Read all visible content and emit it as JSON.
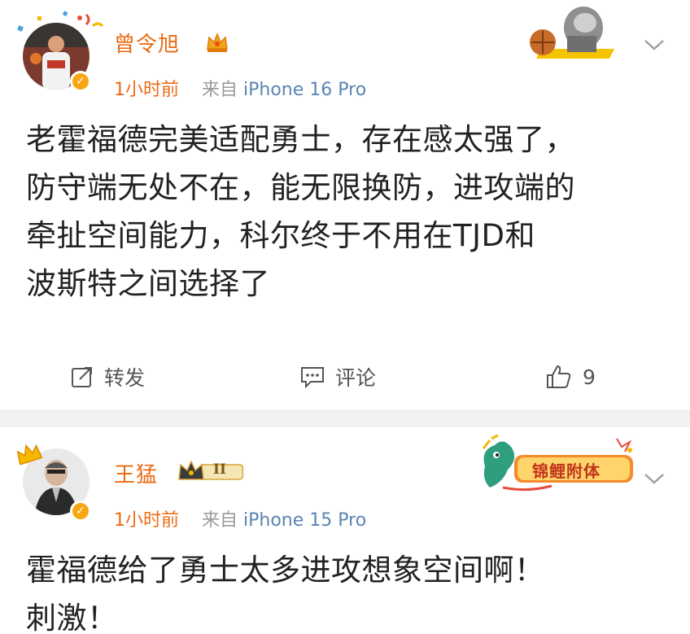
{
  "posts": [
    {
      "username": "曾令旭",
      "time": "1小时前",
      "source_prefix": "来自",
      "device": "iPhone 16 Pro",
      "content_lines": [
        "老霍福德完美适配勇士，存在感太强了，",
        "防守端无处不在，能无限换防，进攻端的",
        "牵扯空间能力，科尔终于不用在TJD和",
        "波斯特之间选择了"
      ],
      "actions": {
        "repost": "转发",
        "comment": "评论",
        "like_count": "9"
      }
    },
    {
      "username": "王猛",
      "level_badge": "II",
      "fan_badge": "锦鲤附体",
      "time": "1小时前",
      "source_prefix": "来自",
      "device": "iPhone 15 Pro",
      "content_lines": [
        "霍福德给了勇士太多进攻想象空间啊！",
        "刺激！"
      ]
    }
  ],
  "colors": {
    "accent": "#eb6a12",
    "device_link": "#5b84b1",
    "gold": "#f6a713"
  }
}
